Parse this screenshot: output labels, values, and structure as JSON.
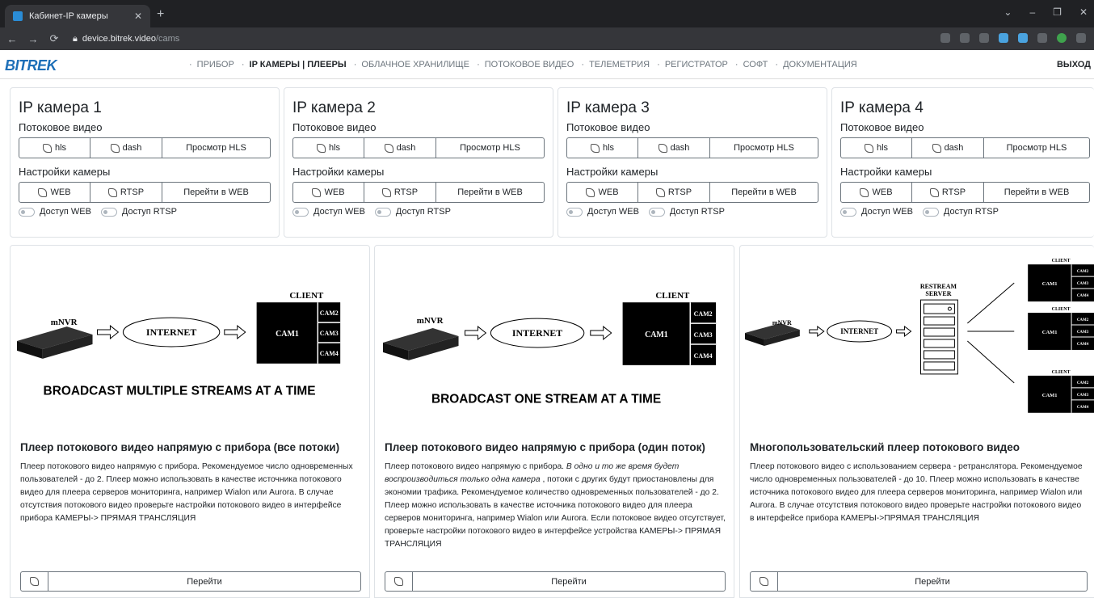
{
  "browser": {
    "tab_title": "Кабинет-IP камеры",
    "url_host": "device.bitrek.video",
    "url_path": "/cams"
  },
  "nav": {
    "logo": "BITREK",
    "items": [
      {
        "label": "ПРИБОР"
      },
      {
        "label": "IP КАМЕРЫ | ПЛЕЕРЫ"
      },
      {
        "label": "ОБЛАЧНОЕ ХРАНИЛИЩЕ"
      },
      {
        "label": "ПОТОКОВОЕ ВИДЕО"
      },
      {
        "label": "ТЕЛЕМЕТРИЯ"
      },
      {
        "label": "РЕГИСТРАТОР"
      },
      {
        "label": "СОФТ"
      },
      {
        "label": "ДОКУМЕНТАЦИЯ"
      }
    ],
    "logout": "ВЫХОД"
  },
  "cameras": [
    {
      "title": "IP камера 1"
    },
    {
      "title": "IP камера 2"
    },
    {
      "title": "IP камера 3"
    },
    {
      "title": "IP камера 4"
    }
  ],
  "camera_labels": {
    "stream_heading": "Потоковое видео",
    "hls": "hls",
    "dash": "dash",
    "view_hls": "Просмотр HLS",
    "settings_heading": "Настройки камеры",
    "web": "WEB",
    "rtsp": "RTSP",
    "go_web": "Перейти в WEB",
    "access_web": "Доступ WEB",
    "access_rtsp": "Доступ RTSP"
  },
  "diagram_text": {
    "mnvr": "mNVR",
    "internet": "INTERNET",
    "client": "CLIENT",
    "cam1": "CAM1",
    "cam2": "CAM2",
    "cam3": "CAM3",
    "cam4": "CAM4",
    "restream": "RESTREAM",
    "server": "SERVER"
  },
  "players": [
    {
      "caption": "BROADCAST MULTIPLE STREAMS AT A TIME",
      "title": "Плеер потокового видео напрямую с прибора (все потоки)",
      "desc": "Плеер потокового видео напрямую с прибора. Рекомендуемое число одновременных пользователей - до 2. Плеер можно использовать в качестве источника потокового видео для плеера серверов мониторинга, например Wialon или Aurora. В случае отсутствия потокового видео проверьте настройки потокового видео в интерфейсе прибора КАМЕРЫ-> ПРЯМАЯ ТРАНСЛЯЦИЯ",
      "button": "Перейти"
    },
    {
      "caption": "BROADCAST ONE STREAM AT A TIME",
      "title": "Плеер потокового видео напрямую с прибора (один поток)",
      "desc_pre": "Плеер потокового видео напрямую с прибора. ",
      "desc_italic": "В одно и то же время будет воспроизводиться только одна камера",
      "desc_post": " , потоки с других будут приостановлены для экономии трафика. Рекомендуемое количество одновременных пользователей - до 2. Плеер можно использовать в качестве источника потокового видео для плеера серверов мониторинга, например Wialon или Aurora. Если потоковое видео отсутствует, проверьте настройки потокового видео в интерфейсе устройства КАМЕРЫ-> ПРЯМАЯ ТРАНСЛЯЦИЯ",
      "button": "Перейти"
    },
    {
      "title": "Многопользовательский плеер потокового видео",
      "desc": "Плеер потокового видео с использованием сервера - ретранслятора. Рекомендуемое число одновременных пользователей - до 10. Плеер можно использовать в качестве источника потокового видео для плеера серверов мониторинга, например Wialon или Aurora. В случае отсутствия потокового видео проверьте настройки потокового видео в интерфейсе прибора КАМЕРЫ->ПРЯМАЯ ТРАНСЛЯЦИЯ",
      "button": "Перейти"
    }
  ]
}
